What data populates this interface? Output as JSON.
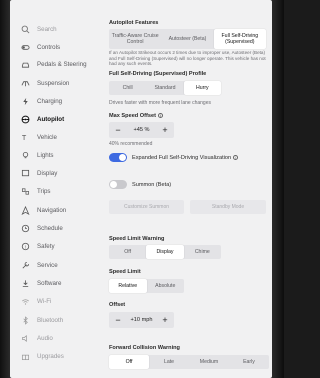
{
  "sidebar": {
    "items": [
      {
        "label": "Search",
        "icon": "search-icon"
      },
      {
        "label": "Controls",
        "icon": "toggle-icon"
      },
      {
        "label": "Pedals & Steering",
        "icon": "car-icon"
      },
      {
        "label": "Suspension",
        "icon": "suspension-icon"
      },
      {
        "label": "Charging",
        "icon": "lightning-icon"
      },
      {
        "label": "Autopilot",
        "icon": "steering-wheel-icon"
      },
      {
        "label": "Vehicle",
        "icon": "vehicle-icon"
      },
      {
        "label": "Lights",
        "icon": "bulb-icon"
      },
      {
        "label": "Display",
        "icon": "display-icon"
      },
      {
        "label": "Trips",
        "icon": "trips-icon"
      },
      {
        "label": "Navigation",
        "icon": "navigation-icon"
      },
      {
        "label": "Schedule",
        "icon": "clock-icon"
      },
      {
        "label": "Safety",
        "icon": "safety-icon"
      },
      {
        "label": "Service",
        "icon": "wrench-icon"
      },
      {
        "label": "Software",
        "icon": "download-icon"
      },
      {
        "label": "Wi-Fi",
        "icon": "wifi-icon"
      },
      {
        "label": "Bluetooth",
        "icon": "bluetooth-icon"
      },
      {
        "label": "Audio",
        "icon": "audio-icon"
      },
      {
        "label": "Upgrades",
        "icon": "upgrades-icon"
      }
    ],
    "active": "Autopilot"
  },
  "autopilot_features": {
    "heading": "Autopilot Features",
    "options": [
      "Traffic-Aware Cruise Control",
      "Autosteer (Beta)",
      "Full Self-Driving (Supervised)"
    ],
    "selected": "Full Self-Driving (Supervised)",
    "warning": "If an Autopilot Strikeout occurs 2 times due to improper use, Autosteer (Beta) and Full Self-Driving (Supervised) will no longer operate. This vehicle has not had any such events."
  },
  "fsd_profile": {
    "heading": "Full Self-Driving (Supervised) Profile",
    "options": [
      "Chill",
      "Standard",
      "Hurry"
    ],
    "selected": "Hurry",
    "description": "Drives faster with more frequent lane changes"
  },
  "max_speed_offset": {
    "heading": "Max Speed Offset",
    "value": "+45 %",
    "minus": "−",
    "plus": "+",
    "recommended": "40% recommended"
  },
  "expanded_viz": {
    "label": "Expanded Full Self-Driving Visualization",
    "on": true
  },
  "summon": {
    "label": "Summon (Beta)",
    "on": false,
    "customize_label": "Customize Summon",
    "standby_label": "Standby Mode"
  },
  "speed_limit_warning": {
    "heading": "Speed Limit Warning",
    "options": [
      "Off",
      "Display",
      "Chime"
    ],
    "selected": "Display"
  },
  "speed_limit": {
    "heading": "Speed Limit",
    "options": [
      "Relative",
      "Absolute"
    ],
    "selected": "Relative"
  },
  "offset": {
    "heading": "Offset",
    "value": "+10 mph",
    "minus": "−",
    "plus": "+"
  },
  "forward_collision": {
    "heading": "Forward Collision Warning",
    "options": [
      "Off",
      "Late",
      "Medium",
      "Early"
    ],
    "selected": "Off"
  },
  "colors": {
    "accent": "#3e6ae1",
    "background": "#f1f1f2",
    "bezel": "#1b1b1b"
  }
}
